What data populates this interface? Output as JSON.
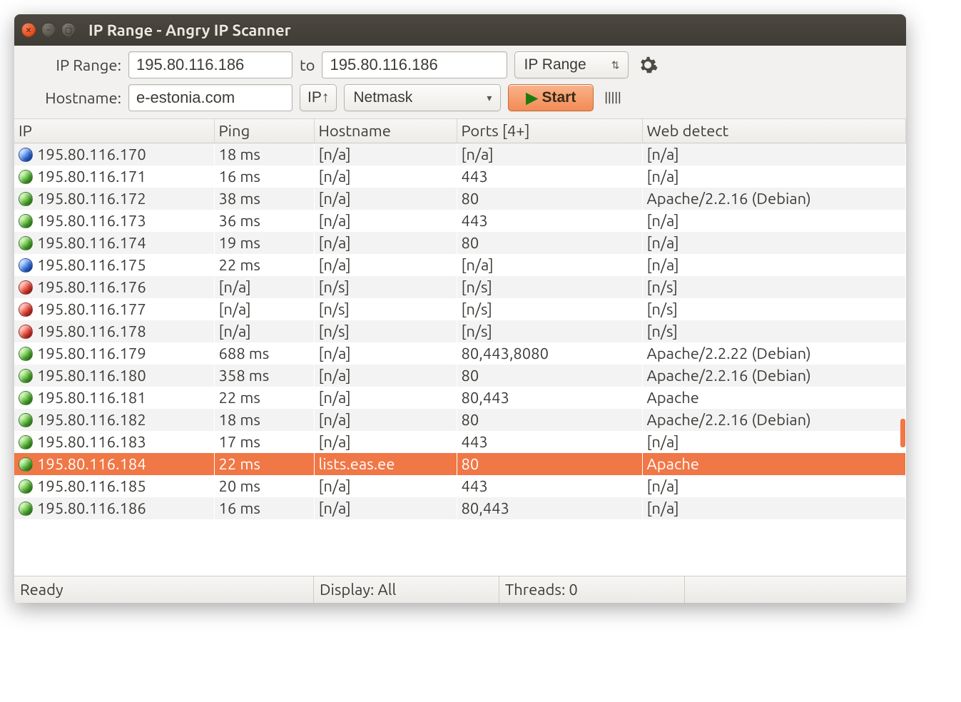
{
  "titlebar": {
    "title": "IP Range - Angry IP Scanner"
  },
  "toolbar": {
    "row1": {
      "label_iprange": "IP Range:",
      "ip_from": "195.80.116.186",
      "label_to": "to",
      "ip_to": "195.80.116.186",
      "mode_select": "IP Range"
    },
    "row2": {
      "label_hostname": "Hostname:",
      "hostname": "e-estonia.com",
      "ip_btn": "IP↑",
      "netmask_select": "Netmask",
      "start_btn": "Start"
    }
  },
  "columns": {
    "ip": "IP",
    "ping": "Ping",
    "hostname": "Hostname",
    "ports": "Ports [4+]",
    "webdetect": "Web detect"
  },
  "rows": [
    {
      "status": "blue",
      "ip": "195.80.116.170",
      "ping": "18 ms",
      "host": "[n/a]",
      "ports": "[n/a]",
      "web": "[n/a]"
    },
    {
      "status": "green",
      "ip": "195.80.116.171",
      "ping": "16 ms",
      "host": "[n/a]",
      "ports": "443",
      "web": "[n/a]"
    },
    {
      "status": "green",
      "ip": "195.80.116.172",
      "ping": "38 ms",
      "host": "[n/a]",
      "ports": "80",
      "web": "Apache/2.2.16 (Debian)"
    },
    {
      "status": "green",
      "ip": "195.80.116.173",
      "ping": "36 ms",
      "host": "[n/a]",
      "ports": "443",
      "web": "[n/a]"
    },
    {
      "status": "green",
      "ip": "195.80.116.174",
      "ping": "19 ms",
      "host": "[n/a]",
      "ports": "80",
      "web": "[n/a]"
    },
    {
      "status": "blue",
      "ip": "195.80.116.175",
      "ping": "22 ms",
      "host": "[n/a]",
      "ports": "[n/a]",
      "web": "[n/a]"
    },
    {
      "status": "red",
      "ip": "195.80.116.176",
      "ping": "[n/a]",
      "host": "[n/s]",
      "ports": "[n/s]",
      "web": "[n/s]"
    },
    {
      "status": "red",
      "ip": "195.80.116.177",
      "ping": "[n/a]",
      "host": "[n/s]",
      "ports": "[n/s]",
      "web": "[n/s]"
    },
    {
      "status": "red",
      "ip": "195.80.116.178",
      "ping": "[n/a]",
      "host": "[n/s]",
      "ports": "[n/s]",
      "web": "[n/s]"
    },
    {
      "status": "green",
      "ip": "195.80.116.179",
      "ping": "688 ms",
      "host": "[n/a]",
      "ports": "80,443,8080",
      "web": "Apache/2.2.22 (Debian)"
    },
    {
      "status": "green",
      "ip": "195.80.116.180",
      "ping": "358 ms",
      "host": "[n/a]",
      "ports": "80",
      "web": "Apache/2.2.16 (Debian)"
    },
    {
      "status": "green",
      "ip": "195.80.116.181",
      "ping": "22 ms",
      "host": "[n/a]",
      "ports": "80,443",
      "web": "Apache"
    },
    {
      "status": "green",
      "ip": "195.80.116.182",
      "ping": "18 ms",
      "host": "[n/a]",
      "ports": "80",
      "web": "Apache/2.2.16 (Debian)"
    },
    {
      "status": "green",
      "ip": "195.80.116.183",
      "ping": "17 ms",
      "host": "[n/a]",
      "ports": "443",
      "web": "[n/a]"
    },
    {
      "status": "green",
      "ip": "195.80.116.184",
      "ping": "22 ms",
      "host": "lists.eas.ee",
      "ports": "80",
      "web": "Apache",
      "selected": true
    },
    {
      "status": "green",
      "ip": "195.80.116.185",
      "ping": "20 ms",
      "host": "[n/a]",
      "ports": "443",
      "web": "[n/a]"
    },
    {
      "status": "green",
      "ip": "195.80.116.186",
      "ping": "16 ms",
      "host": "[n/a]",
      "ports": "80,443",
      "web": "[n/a]"
    }
  ],
  "statusbar": {
    "ready": "Ready",
    "display": "Display: All",
    "threads": "Threads: 0"
  }
}
